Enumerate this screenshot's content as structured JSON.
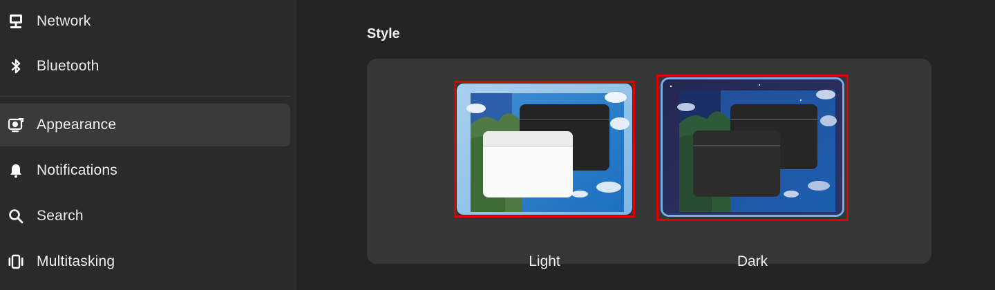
{
  "sidebar": {
    "items": [
      {
        "label": "Network",
        "icon": "network-icon"
      },
      {
        "label": "Bluetooth",
        "icon": "bluetooth-icon"
      },
      {
        "label": "Appearance",
        "icon": "appearance-icon",
        "active": true
      },
      {
        "label": "Notifications",
        "icon": "bell-icon"
      },
      {
        "label": "Search",
        "icon": "search-icon"
      },
      {
        "label": "Multitasking",
        "icon": "multitasking-icon"
      }
    ]
  },
  "main": {
    "style_section": {
      "title": "Style",
      "options": [
        {
          "label": "Light",
          "selected": false
        },
        {
          "label": "Dark",
          "selected": true
        }
      ]
    }
  },
  "colors": {
    "accent": "#78aeed",
    "highlight_box": "#e00000",
    "sidebar_bg": "#2a2a2a",
    "card_bg": "#363636"
  }
}
